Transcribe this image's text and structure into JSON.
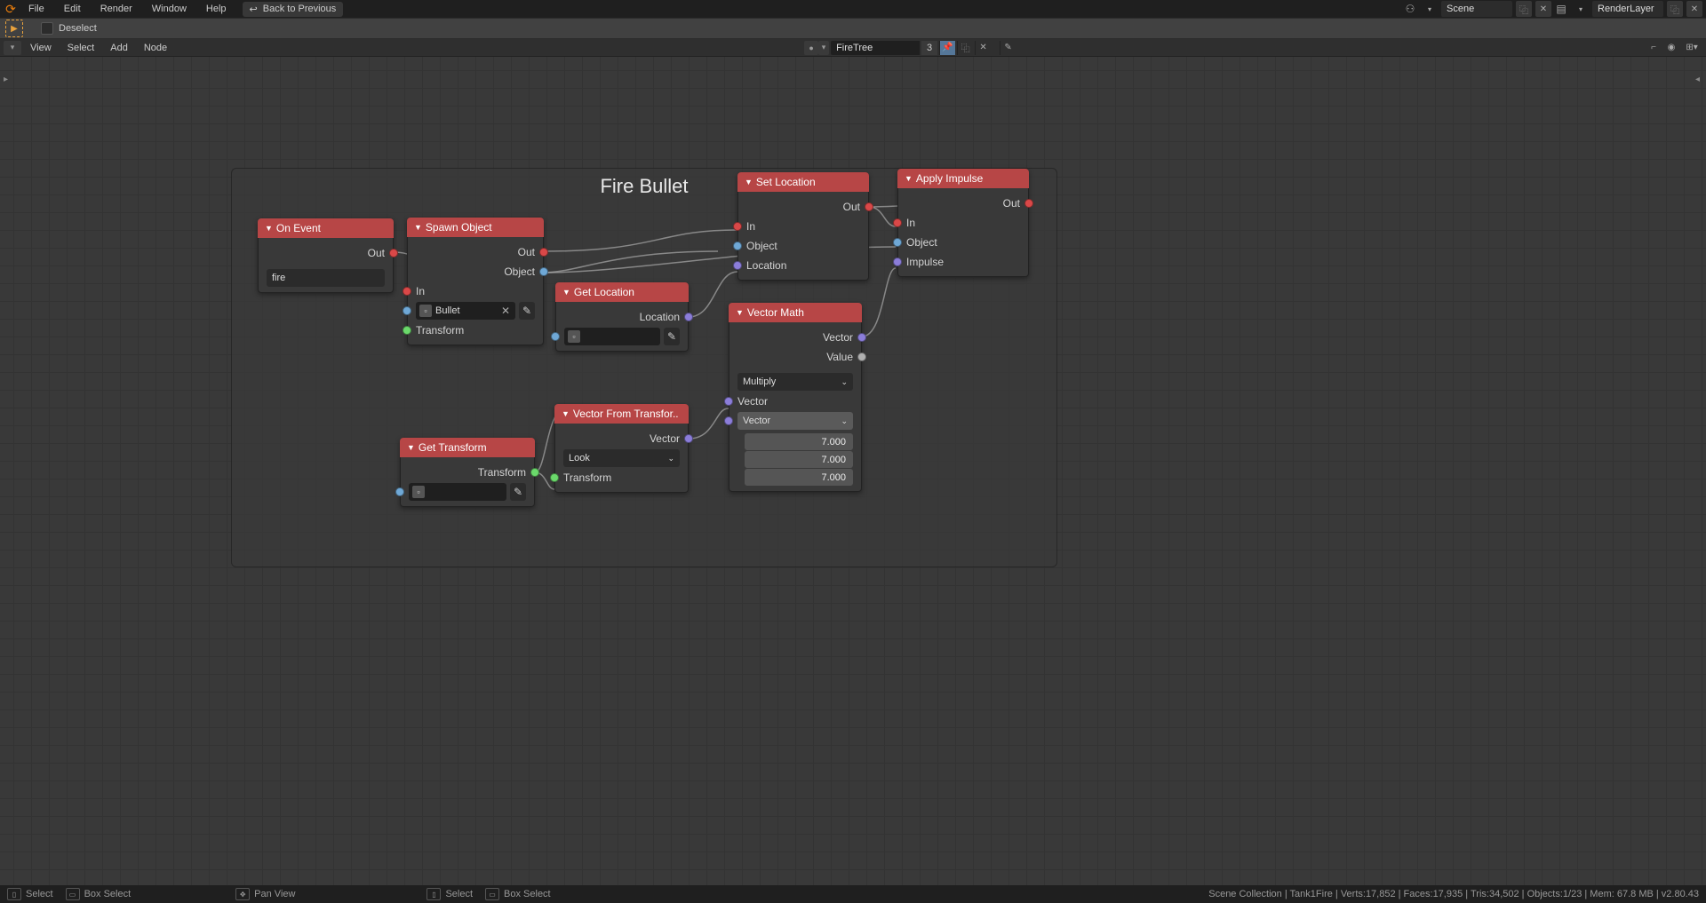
{
  "topbar": {
    "menus": [
      "File",
      "Edit",
      "Render",
      "Window",
      "Help"
    ],
    "back": "Back to Previous",
    "scene_label": "Scene",
    "layer_label": "RenderLayer"
  },
  "secondbar": {
    "deselect": "Deselect"
  },
  "thirdbar": {
    "menus": [
      "View",
      "Select",
      "Add",
      "Node"
    ],
    "tree_name": "FireTree",
    "users": "3"
  },
  "frame": {
    "title": "Fire Bullet"
  },
  "nodes": {
    "on_event": {
      "title": "On Event",
      "out": "Out",
      "value": "fire"
    },
    "spawn": {
      "title": "Spawn Object",
      "out": "Out",
      "obj_out": "Object",
      "in": "In",
      "obj_val": "Bullet",
      "transform": "Transform"
    },
    "getloc": {
      "title": "Get Location",
      "out": "Location"
    },
    "gettrans": {
      "title": "Get Transform",
      "out": "Transform"
    },
    "vecfrom": {
      "title": "Vector From Transfor..",
      "out": "Vector",
      "mode": "Look",
      "in": "Transform"
    },
    "setloc": {
      "title": "Set Location",
      "out": "Out",
      "in": "In",
      "obj": "Object",
      "loc": "Location"
    },
    "vmath": {
      "title": "Vector Math",
      "outv": "Vector",
      "outval": "Value",
      "op": "Multiply",
      "in1": "Vector",
      "in2": "Vector",
      "nums": [
        "7.000",
        "7.000",
        "7.000"
      ]
    },
    "impulse": {
      "title": "Apply Impulse",
      "out": "Out",
      "in": "In",
      "obj": "Object",
      "imp": "Impulse"
    }
  },
  "status": {
    "left": [
      {
        "icon": "▯",
        "label": "Select"
      },
      {
        "icon": "▭",
        "label": "Box Select"
      },
      {
        "icon": "✥",
        "label": "Pan View"
      },
      {
        "icon": "▯",
        "label": "Select"
      },
      {
        "icon": "▭",
        "label": "Box Select"
      }
    ],
    "right": "Scene Collection | Tank1Fire | Verts:17,852 | Faces:17,935 | Tris:34,502 | Objects:1/23 | Mem: 67.8 MB | v2.80.43"
  }
}
